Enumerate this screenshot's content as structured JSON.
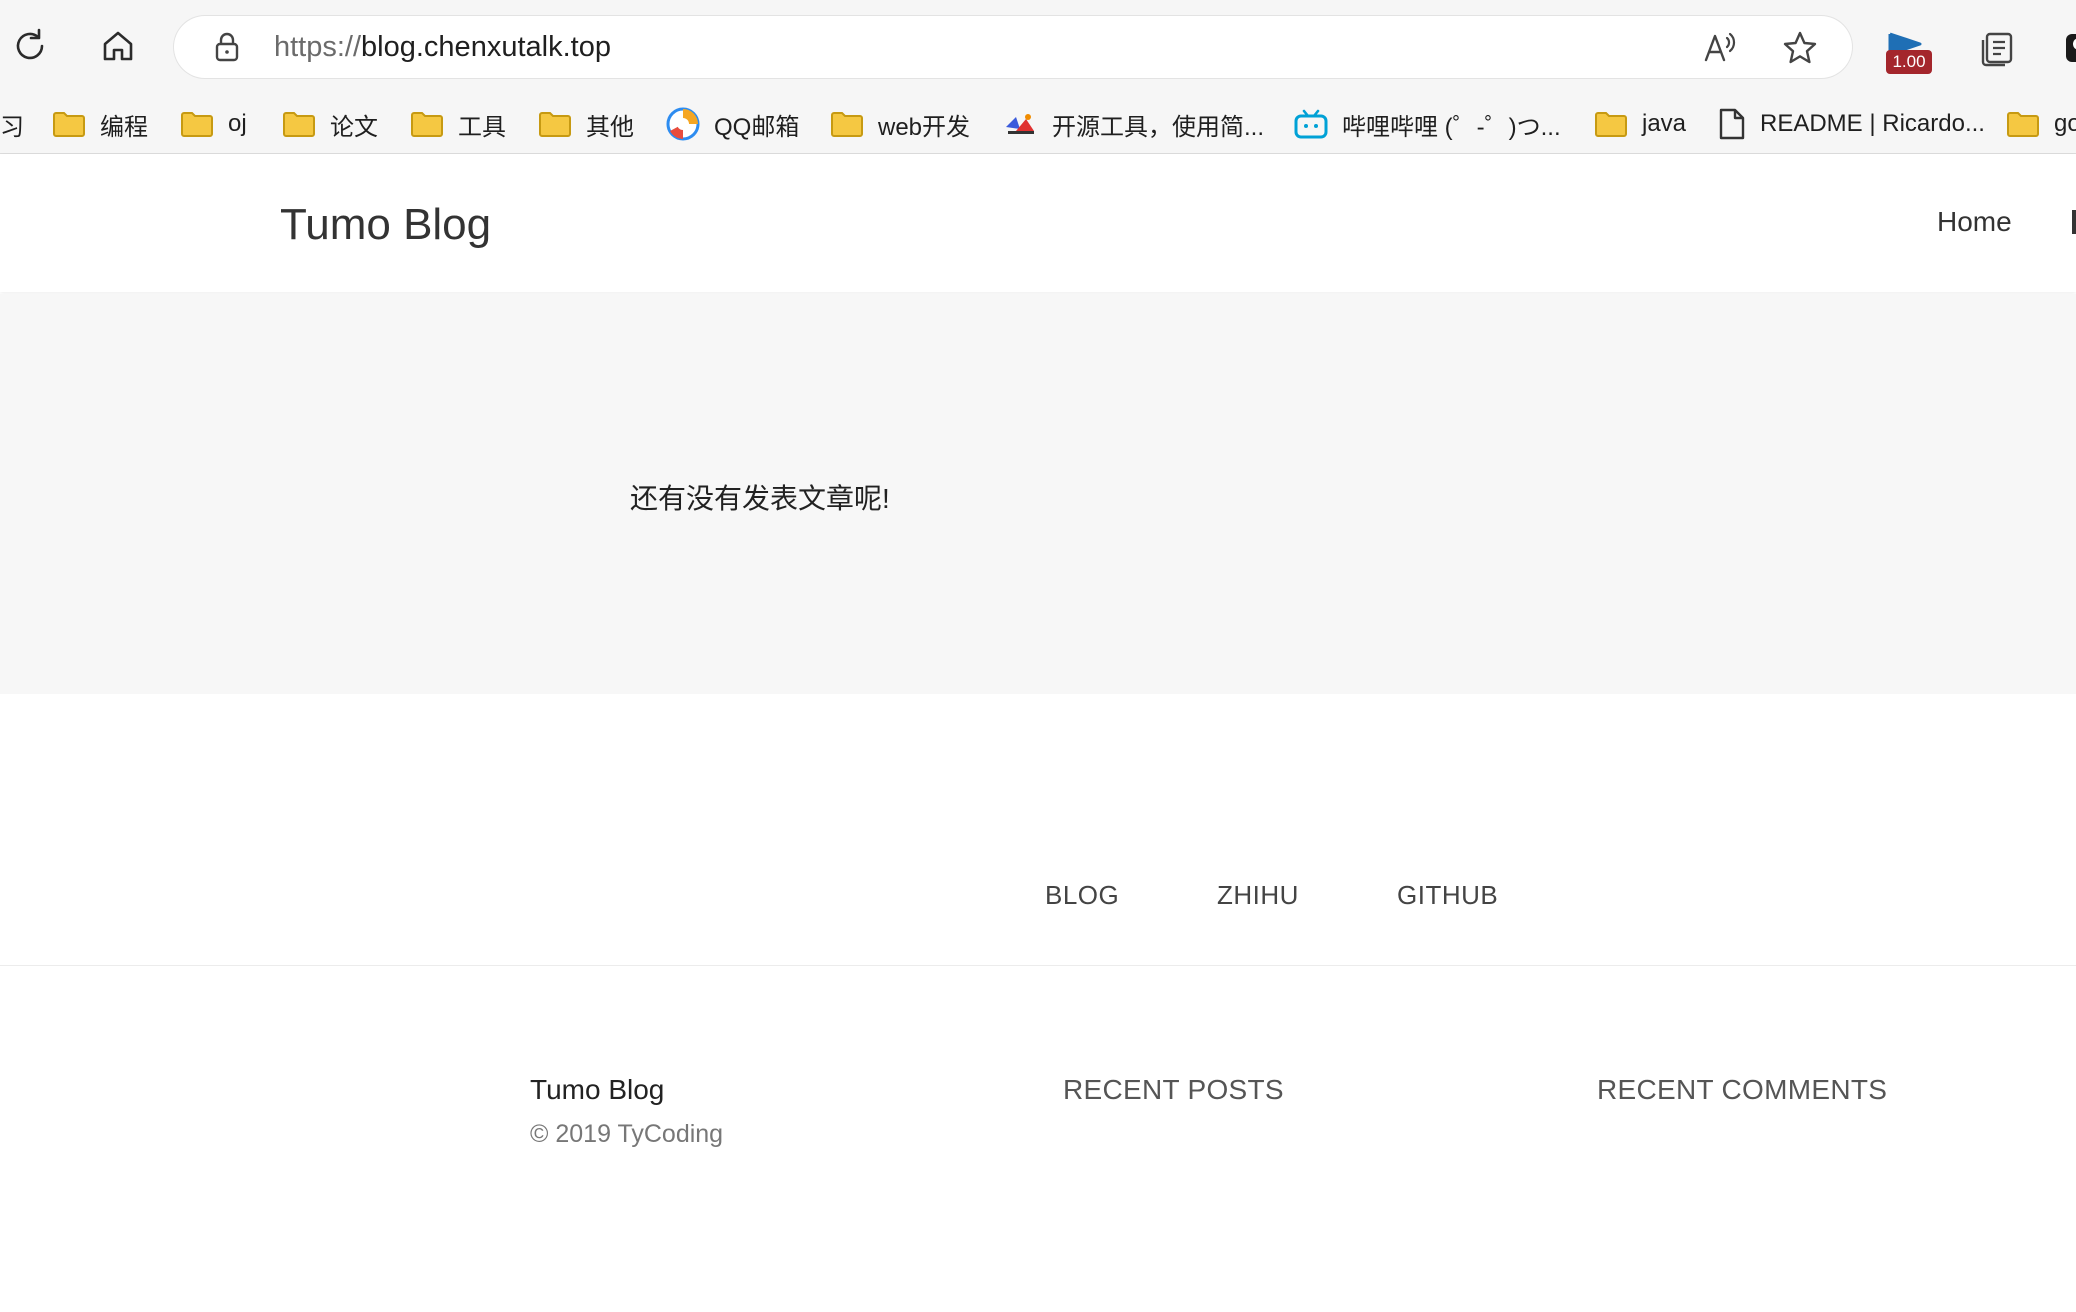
{
  "browser": {
    "url_scheme": "https://",
    "url_host": "blog.chenxutalk.top",
    "extension_badge": "1.00",
    "bookmarks": [
      {
        "label": "习",
        "type": "text"
      },
      {
        "label": "编程",
        "type": "folder"
      },
      {
        "label": "oj",
        "type": "folder"
      },
      {
        "label": "论文",
        "type": "folder"
      },
      {
        "label": "工具",
        "type": "folder"
      },
      {
        "label": "其他",
        "type": "folder"
      },
      {
        "label": "QQ邮箱",
        "type": "qqmail"
      },
      {
        "label": "web开发",
        "type": "folder"
      },
      {
        "label": "开源工具，使用简...",
        "type": "site"
      },
      {
        "label": "哔哩哔哩 (゜-゜)つ...",
        "type": "bilibili"
      },
      {
        "label": "java",
        "type": "folder"
      },
      {
        "label": "README | Ricardo...",
        "type": "page"
      },
      {
        "label": "go",
        "type": "folder"
      }
    ]
  },
  "site": {
    "brand": "Tumo Blog",
    "nav_home": "Home",
    "empty_message": "还有没有发表文章呢!",
    "footer_links": [
      "BLOG",
      "ZHIHU",
      "GITHUB"
    ],
    "footer": {
      "brand": "Tumo Blog",
      "copyright": "© 2019 TyCoding",
      "recent_posts": "RECENT POSTS",
      "recent_comments": "RECENT COMMENTS"
    }
  },
  "colors": {
    "folder_fill": "#f5c842",
    "folder_stroke": "#c79a12",
    "badge_bg": "#a4262c",
    "content_band_bg": "#f7f7f7",
    "bilibili_blue": "#00a1d6"
  }
}
